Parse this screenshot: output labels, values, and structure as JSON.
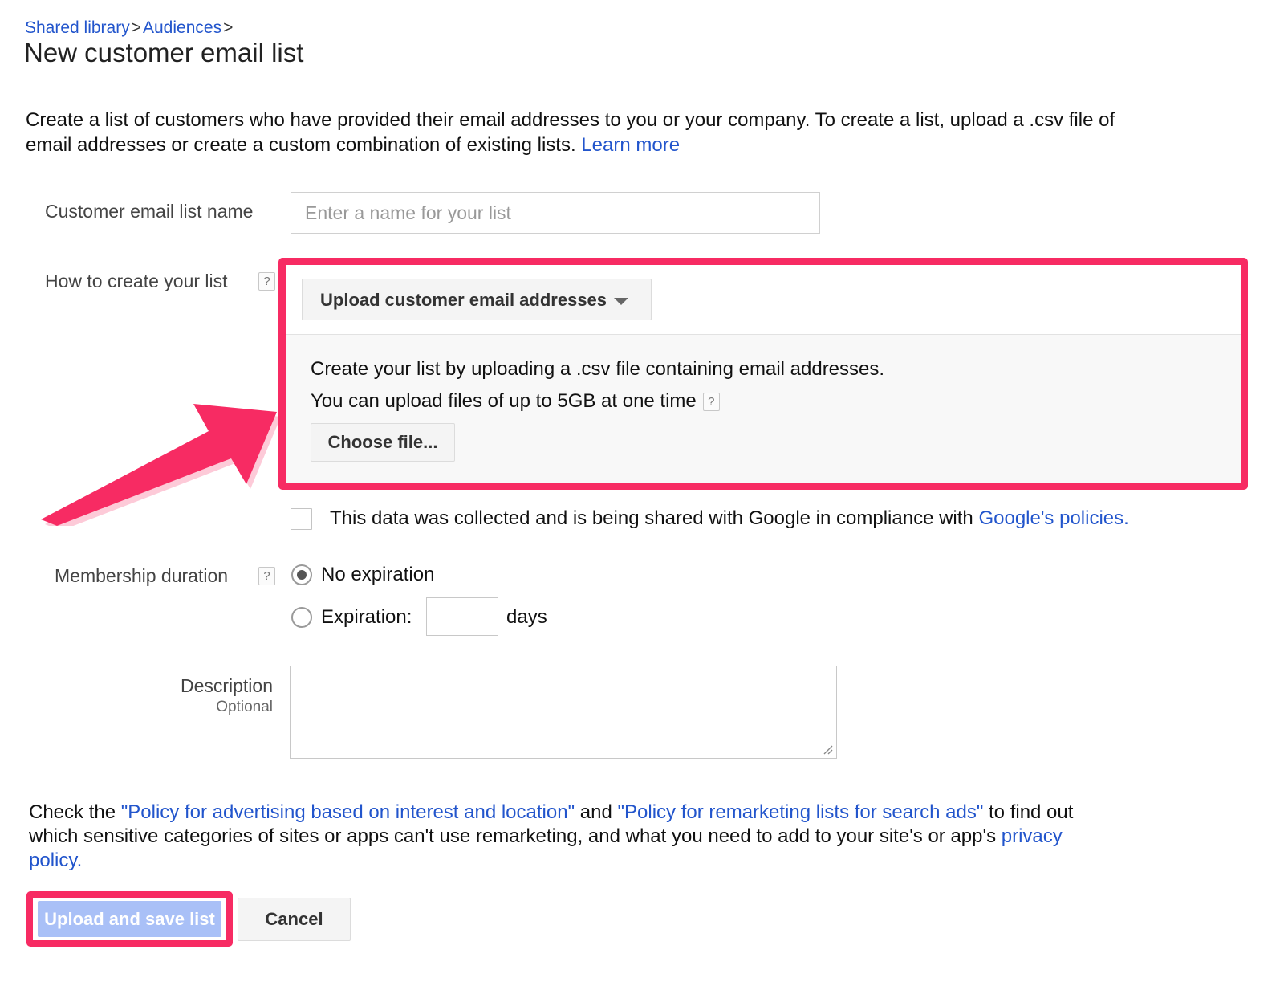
{
  "breadcrumb": {
    "items": [
      "Shared library",
      "Audiences"
    ],
    "separator": ">",
    "trailing_separator": ">"
  },
  "page_title": "New customer email list",
  "intro": {
    "text": "Create a list of customers who have provided their email addresses to you or your company. To create a list, upload a .csv file of email addresses or create a custom combination of existing lists.",
    "learn_more": "Learn more"
  },
  "fields": {
    "name": {
      "label": "Customer email list name",
      "placeholder": "Enter a name for your list",
      "value": ""
    },
    "how_to_create": {
      "label": "How to create your list",
      "help_icon": "?",
      "selected_option": "Upload customer email addresses",
      "caret_icon": "chevron-down-icon"
    },
    "upload_panel": {
      "line1": "Create your list by uploading a .csv file containing email addresses.",
      "line2": "You can upload files of up to 5GB at one time",
      "line2_help_icon": "?",
      "choose_file_label": "Choose file..."
    },
    "compliance": {
      "checked": false,
      "text": "This data was collected and is being shared with Google in compliance with ",
      "link": "Google's policies."
    },
    "membership_duration": {
      "label": "Membership duration",
      "help_icon": "?",
      "options": [
        {
          "label": "No expiration",
          "selected": true
        },
        {
          "label": "Expiration:",
          "selected": false
        }
      ],
      "expiration_value": "",
      "days_suffix": "days"
    },
    "description": {
      "label": "Description",
      "sublabel": "Optional",
      "value": ""
    }
  },
  "policy": {
    "prefix": "Check the ",
    "link1": "\"Policy for advertising based on interest and location\"",
    "middle": " and ",
    "link2": "\"Policy for remarketing lists for search ads\"",
    "suffix": " to find out which sensitive categories of sites or apps can't use remarketing, and what you need to add to your site's or app's ",
    "link3": "privacy policy."
  },
  "buttons": {
    "submit": "Upload and save list",
    "cancel": "Cancel"
  },
  "annotations": {
    "highlight_color": "#f72b63",
    "arrow": "arrow-up-right",
    "highlighted_regions": [
      "upload-panel",
      "upload-and-save-button"
    ]
  },
  "colors": {
    "link": "#2255cc",
    "highlight": "#f72b63",
    "submit_button_bg": "#a9c0f7",
    "panel_bg": "#f8f8f8",
    "button_bg": "#f4f4f4"
  }
}
